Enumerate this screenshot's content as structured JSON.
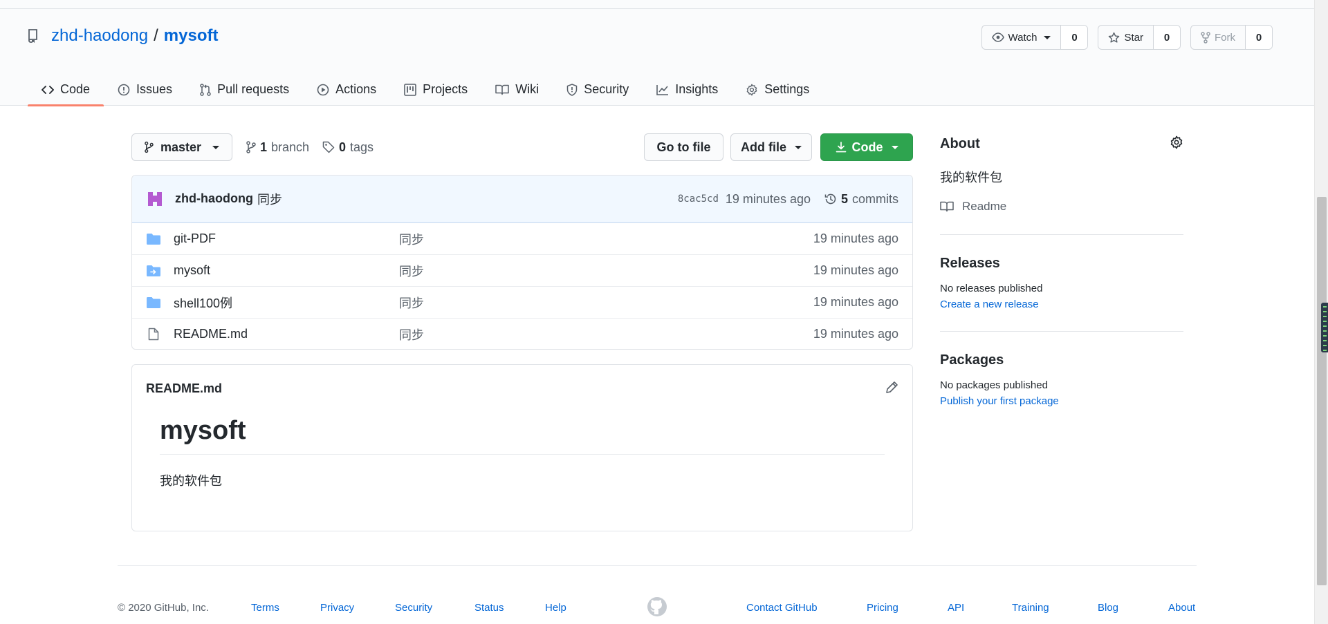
{
  "repo": {
    "owner": "zhd-haodong",
    "separator": "/",
    "name": "mysoft"
  },
  "actions": {
    "watch": {
      "label": "Watch",
      "count": "0"
    },
    "star": {
      "label": "Star",
      "count": "0"
    },
    "fork": {
      "label": "Fork",
      "count": "0"
    }
  },
  "tabs": [
    {
      "label": "Code",
      "icon": "code-icon",
      "selected": true
    },
    {
      "label": "Issues",
      "icon": "issue-icon"
    },
    {
      "label": "Pull requests",
      "icon": "pull-request-icon"
    },
    {
      "label": "Actions",
      "icon": "play-icon"
    },
    {
      "label": "Projects",
      "icon": "project-icon"
    },
    {
      "label": "Wiki",
      "icon": "book-icon"
    },
    {
      "label": "Security",
      "icon": "shield-icon"
    },
    {
      "label": "Insights",
      "icon": "graph-icon"
    },
    {
      "label": "Settings",
      "icon": "gear-icon"
    }
  ],
  "toolbar": {
    "branch": "master",
    "branches_count": "1",
    "branches_label": "branch",
    "tags_count": "0",
    "tags_label": "tags",
    "go_to_file": "Go to file",
    "add_file": "Add file",
    "code": "Code"
  },
  "commit": {
    "author": "zhd-haodong",
    "message": "同步",
    "sha": "8cac5cd",
    "age": "19 minutes ago",
    "commits_count": "5",
    "commits_label": "commits"
  },
  "files": [
    {
      "name": "git-PDF",
      "type": "folder",
      "message": "同步",
      "age": "19 minutes ago"
    },
    {
      "name": "mysoft",
      "type": "submodule",
      "message": "同步",
      "age": "19 minutes ago"
    },
    {
      "name": "shell100例",
      "type": "folder",
      "message": "同步",
      "age": "19 minutes ago"
    },
    {
      "name": "README.md",
      "type": "file",
      "message": "同步",
      "age": "19 minutes ago"
    }
  ],
  "readme": {
    "filename": "README.md",
    "heading": "mysoft",
    "body": "我的软件包"
  },
  "sidebar": {
    "about_title": "About",
    "description": "我的软件包",
    "readme_label": "Readme",
    "releases_title": "Releases",
    "releases_text": "No releases published",
    "releases_link": "Create a new release",
    "packages_title": "Packages",
    "packages_text": "No packages published",
    "packages_link": "Publish your first package"
  },
  "footer": {
    "copyright": "© 2020 GitHub, Inc.",
    "left_links": [
      "Terms",
      "Privacy",
      "Security",
      "Status",
      "Help"
    ],
    "right_links": [
      "Contact GitHub",
      "Pricing",
      "API",
      "Training",
      "Blog",
      "About"
    ]
  },
  "colors": {
    "link": "#0366d6",
    "primary_button": "#2ea44f",
    "tab_underline": "#f9826c",
    "commit_bar": "#f1f8ff",
    "folder": "#79b8ff"
  }
}
